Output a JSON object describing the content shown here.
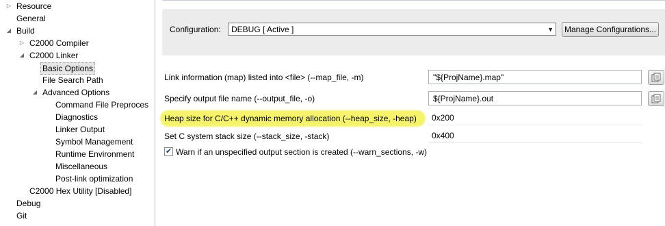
{
  "tree": {
    "items": [
      {
        "label": "Resource",
        "arrow": "▷"
      },
      {
        "label": "General",
        "arrow": ""
      },
      {
        "label": "Build",
        "arrow": "◢"
      },
      {
        "label": "C2000 Compiler",
        "arrow": "▷"
      },
      {
        "label": "C2000 Linker",
        "arrow": "◢"
      },
      {
        "label": "Basic Options",
        "arrow": ""
      },
      {
        "label": "File Search Path",
        "arrow": ""
      },
      {
        "label": "Advanced Options",
        "arrow": "◢"
      },
      {
        "label": "Command File Preproces",
        "arrow": ""
      },
      {
        "label": "Diagnostics",
        "arrow": ""
      },
      {
        "label": "Linker Output",
        "arrow": ""
      },
      {
        "label": "Symbol Management",
        "arrow": ""
      },
      {
        "label": "Runtime Environment",
        "arrow": ""
      },
      {
        "label": "Miscellaneous",
        "arrow": ""
      },
      {
        "label": "Post-link optimization",
        "arrow": ""
      },
      {
        "label": "C2000 Hex Utility  [Disabled]",
        "arrow": ""
      },
      {
        "label": "Debug",
        "arrow": ""
      },
      {
        "label": "Git",
        "arrow": ""
      }
    ],
    "selected": "Basic Options"
  },
  "config": {
    "label": "Configuration:",
    "value": "DEBUG  [ Active ]",
    "manage_button": "Manage Configurations..."
  },
  "options": {
    "map_file_label": "Link information (map) listed into <file> (--map_file, -m)",
    "map_file_value": "\"${ProjName}.map\"",
    "output_file_label": "Specify output file name (--output_file, -o)",
    "output_file_value": "${ProjName}.out",
    "heap_label": "Heap size for C/C++ dynamic memory allocation (--heap_size, -heap)",
    "heap_value": "0x200",
    "stack_label": "Set C system stack size (--stack_size, -stack)",
    "stack_value": "0x400",
    "warn_label": "Warn if an unspecified output section is created (--warn_sections, -w)",
    "warn_checked": true
  },
  "colors": {
    "highlight": "#f5f36b",
    "selection": "#e5e5e5"
  }
}
